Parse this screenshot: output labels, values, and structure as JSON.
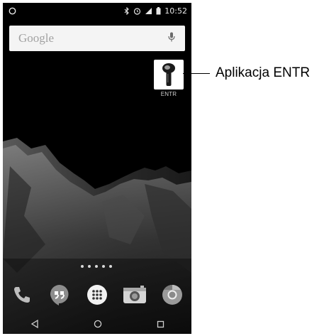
{
  "status_bar": {
    "time": "10:52",
    "icons": [
      "bluetooth-icon",
      "alarm-icon",
      "signal-icon",
      "battery-icon"
    ]
  },
  "search_widget": {
    "label": "Google",
    "icon": "mic-icon"
  },
  "home_apps": [
    {
      "label": "ENTR",
      "icon": "entr-key-icon"
    }
  ],
  "page_indicator": {
    "pages": 5
  },
  "dock": [
    {
      "icon": "phone-icon"
    },
    {
      "icon": "hangouts-icon"
    },
    {
      "icon": "app-drawer-icon"
    },
    {
      "icon": "camera-icon"
    },
    {
      "icon": "chrome-icon"
    }
  ],
  "nav_bar": [
    "back-icon",
    "home-icon",
    "recents-icon"
  ],
  "annotation": {
    "text": "Aplikacja ENTR"
  },
  "colors": {
    "background": "#000000",
    "search_bg": "#f4f4f4",
    "annotation_text": "#000000"
  }
}
